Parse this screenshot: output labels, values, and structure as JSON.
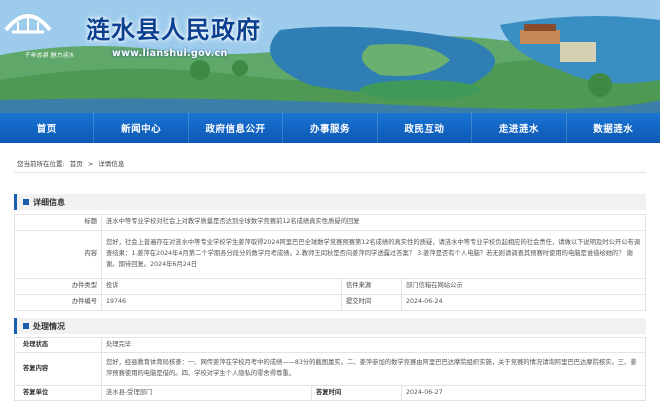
{
  "site": {
    "title": "涟水县人民政府",
    "url": "www.lianshui.gov.cn",
    "seal_text": "千年古县 魅力涟水"
  },
  "nav": [
    "首页",
    "新闻中心",
    "政府信息公开",
    "办事服务",
    "政民互动",
    "走进涟水",
    "数据涟水"
  ],
  "breadcrumb": {
    "prefix": "您当前所在位置:",
    "items": [
      "首页",
      "详情信息"
    ]
  },
  "detail": {
    "heading": "详细信息",
    "rows": {
      "title_label": "标题",
      "title_value": "涟水中等专业学校对社会上对教学质量是否达到全球数学竞赛前12名成绩真实性质疑的回复",
      "content_label": "内容",
      "content_value": "您好，社会上普遍存在对涟水中等专业学校学生姜萍取得2024阿里巴巴全球数学竞赛预赛第12名成绩的真实性的质疑，请涟水中等专业学校负起相应的社会责任，请做以下说明及时公开公布调查结果：1.姜萍在2024年4月第二个学期各分段分的数学月考成绩。2.教师王闰秋是否向姜萍同学透露过答案？ 3.姜萍是否有个人电脑？若无则请调查其预赛时使用的电脑是谁借给她的？ 谢谢。期待回复。2024年6月24日",
      "type_label": "办件类型",
      "type_value": "投诉",
      "source_label": "信件来源",
      "source_value": "部门信箱在网站公示",
      "id_label": "办件编号",
      "id_value": "19746",
      "date_label": "提交时间",
      "date_value": "2024-06-24"
    }
  },
  "process": {
    "heading": "处理情况",
    "status_label": "处理状态",
    "status_value": "处理完毕",
    "reply_label": "答复内容",
    "reply_value": "您好，经县教育体育局核查：一、网传姜萍在学校月考中的成绩——83分的截图属实。二、姜萍参加的数学竞赛由阿里巴巴达摩院组织实施，关于竞赛的情况请询阿里巴巴达摩院核实。三、姜萍预赛使用的电脑是借的。四、学校对学生个人隐私的零舍得尊重。",
    "dept_label": "答复单位",
    "dept_value": "涟水县-受理部门",
    "reply_date_label": "答复时间",
    "reply_date_value": "2024-06-27"
  }
}
